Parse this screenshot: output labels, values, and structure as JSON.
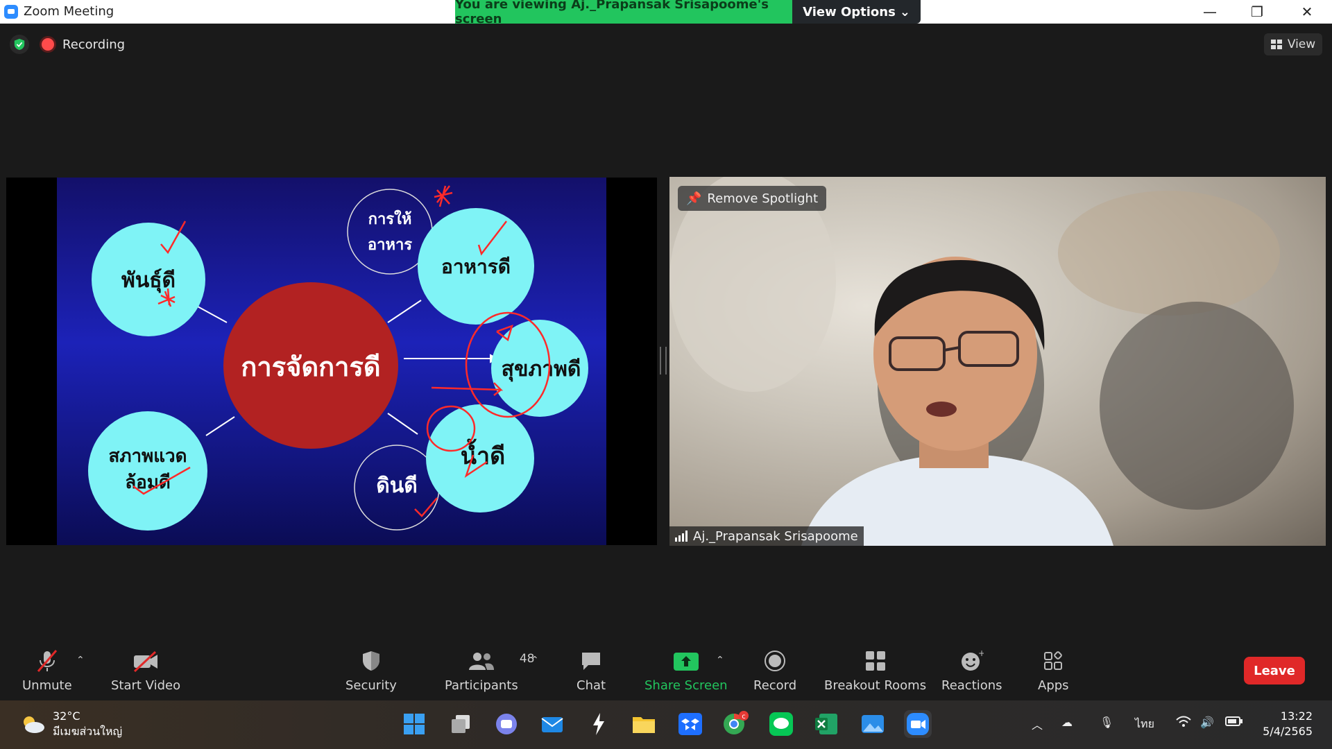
{
  "window": {
    "title": "Zoom Meeting",
    "banner": "You are viewing Aj._Prapansak  Srisapoome's screen",
    "view_options": "View Options",
    "minimize": "—",
    "restore": "❐",
    "close": "✕"
  },
  "status": {
    "recording": "Recording",
    "view": "View"
  },
  "slide": {
    "center": "การจัดการดี",
    "top_left": "พันธุ์ดี",
    "top_small_line1": "การให้",
    "top_small_line2": "อาหาร",
    "top_right": "อาหารดี",
    "right": "สุขภาพดี",
    "bottom_left_line1": "สภาพแวด",
    "bottom_left_line2": "ล้อมดี",
    "bottom_small": "ดินดี",
    "bottom_right": "น้ำดี"
  },
  "video": {
    "spotlight": "Remove Spotlight",
    "participant": "Aj._Prapansak  Srisapoome"
  },
  "toolbar": {
    "unmute": "Unmute",
    "start_video": "Start Video",
    "security": "Security",
    "participants": "Participants",
    "participant_count": "48",
    "chat": "Chat",
    "share_screen": "Share Screen",
    "record": "Record",
    "breakout": "Breakout Rooms",
    "reactions": "Reactions",
    "apps": "Apps",
    "leave": "Leave"
  },
  "taskbar": {
    "temp": "32°C",
    "weather_desc": "มีเมฆส่วนใหญ่",
    "lang": "ไทย",
    "time": "13:22",
    "date": "5/4/2565",
    "chrome_badge": "c"
  },
  "colors": {
    "accent_green": "#22c55e",
    "leave_red": "#e02828",
    "slide_bubble": "#7ff3f6",
    "slide_center": "#b22222",
    "annotation": "#ff2a2a"
  }
}
